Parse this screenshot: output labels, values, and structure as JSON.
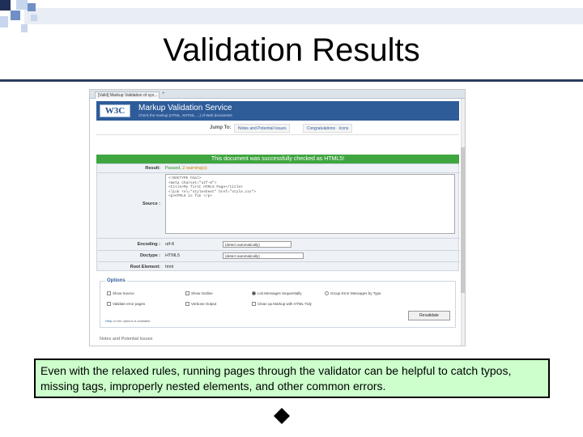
{
  "slide": {
    "title": "Validation Results",
    "caption": "Even with the relaxed rules, running pages through the validator can be helpful to catch typos, missing tags, improperly nested elements, and other common errors.",
    "accent_color": "#2b3e5c",
    "caption_bg": "#ccffcc"
  },
  "browser": {
    "tab_title": "[Valid] Markup Validation of sys...",
    "new_tab": "+"
  },
  "validator": {
    "logo": "W3C",
    "service_title": "Markup Validation Service",
    "service_subtitle": "Check the markup (HTML, XHTML, ...) of Web documents",
    "jump_label": "Jump To:",
    "jump_links": [
      "Notes and Potential Issues",
      "Congratulations · Icons"
    ],
    "success_message": "This document was successfully checked as HTML5!",
    "result_label": "Result:",
    "result_pass": "Passed,",
    "result_warnings": "2 warning(s)",
    "source_label": "Source :",
    "source_lines": [
      "<!DOCTYPE html>",
      "<meta charset=\"utf-8\">",
      "<title>My first HTML5 Page</title>",
      "<link rel=\"stylesheet\" href=\"style.css\">",
      "<p>HTML5 is fun </p>"
    ],
    "encoding_label": "Encoding :",
    "encoding_value": "utf-8",
    "encoding_select": "(detect automatically)",
    "doctype_label": "Doctype :",
    "doctype_value": "HTML5",
    "doctype_select": "(detect automatically)",
    "root_label": "Root Element:",
    "root_value": "html",
    "options_legend": "Options",
    "options": {
      "show_source": "Show Source",
      "show_outline": "Show Outline",
      "list_sequentially": "List Messages Sequentially",
      "group_by_type": "Group Error Messages by Type",
      "relaxed": "Validate error pages",
      "verbose": "Verbose Output",
      "clean_up": "Clean up Markup with HTML-Tidy"
    },
    "help_key": "Help",
    "help_text": "on the options is available.",
    "revalidate_label": "Revalidate",
    "notes_heading": "Notes and Potential Issues"
  }
}
